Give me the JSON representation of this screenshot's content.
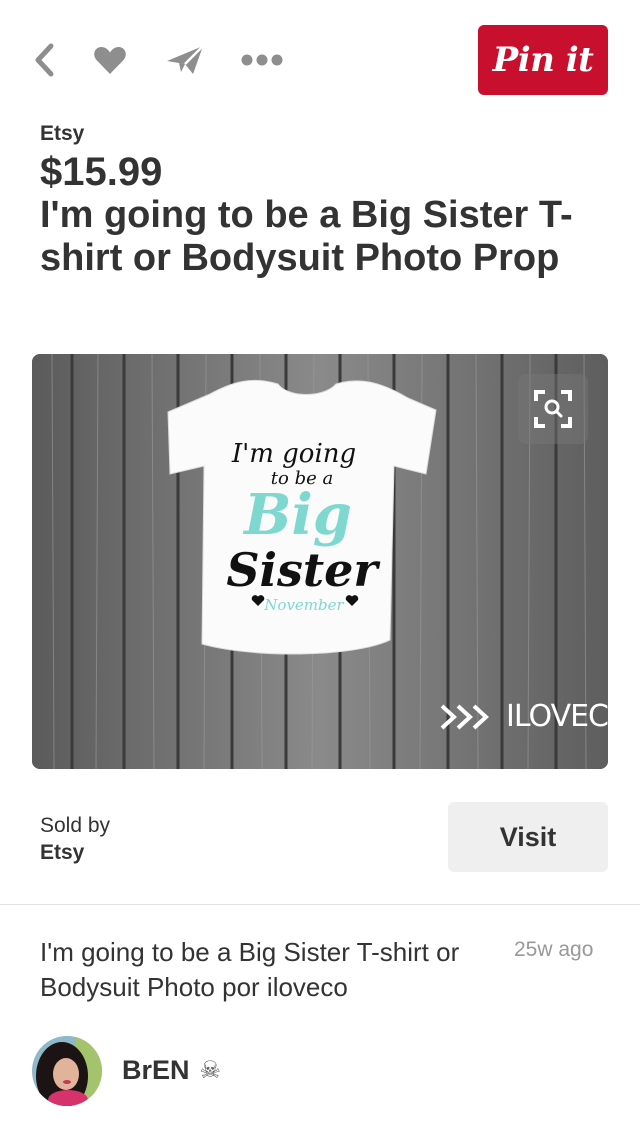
{
  "toolbar": {
    "back_icon": "chevron-left-icon",
    "like_icon": "heart-icon",
    "send_icon": "paper-plane-icon",
    "more_icon": "more-dots-icon",
    "pin_label": "Pin it",
    "pin_color": "#c8102e"
  },
  "pin": {
    "source": "Etsy",
    "price": "$15.99",
    "title": "I'm going to be a Big Sister T-shirt or Bodysuit Photo Prop",
    "image": {
      "shirt_line1": "I'm going",
      "shirt_line2": "to be a",
      "shirt_line3": "Big",
      "shirt_line4": "Sister",
      "shirt_line5": "November",
      "watermark": "ILOVECO",
      "zoom_icon": "visual-search-icon",
      "accent_color": "#7fd8cf"
    }
  },
  "seller": {
    "sold_by_label": "Sold by",
    "name": "Etsy",
    "visit_label": "Visit"
  },
  "description": {
    "text": "I'm going to be a Big Sister T-shirt or Bodysuit Photo por iloveco",
    "age": "25w ago"
  },
  "user": {
    "name": "BrEN",
    "badge": "☠"
  }
}
